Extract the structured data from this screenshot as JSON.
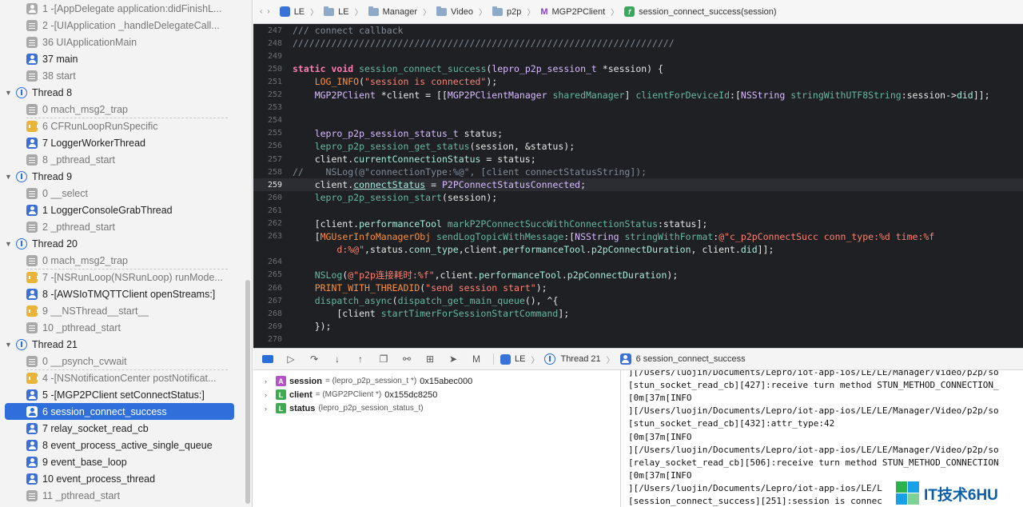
{
  "navigator": {
    "rows": [
      {
        "kind": "frame",
        "icon": "user",
        "dim": true,
        "label": "1 -[AppDelegate application:didFinishL..."
      },
      {
        "kind": "frame",
        "icon": "sys",
        "dim": true,
        "label": "2 -[UIApplication _handleDelegateCall..."
      },
      {
        "kind": "frame",
        "icon": "sys",
        "dim": true,
        "label": "36 UIApplicationMain"
      },
      {
        "kind": "frame",
        "icon": "user",
        "dim": false,
        "label": "37 main"
      },
      {
        "kind": "frame",
        "icon": "sys",
        "dim": true,
        "label": "38 start"
      },
      {
        "kind": "thread",
        "label": "Thread 8"
      },
      {
        "kind": "frame",
        "icon": "sys",
        "dim": true,
        "label": "0 mach_msg2_trap"
      },
      {
        "kind": "frame",
        "icon": "lib",
        "dim": true,
        "label": "6 CFRunLoopRunSpecific",
        "sepBefore": true
      },
      {
        "kind": "frame",
        "icon": "user",
        "dim": false,
        "label": "7 LoggerWorkerThread"
      },
      {
        "kind": "frame",
        "icon": "sys",
        "dim": true,
        "label": "8 _pthread_start"
      },
      {
        "kind": "thread",
        "label": "Thread 9"
      },
      {
        "kind": "frame",
        "icon": "sys",
        "dim": true,
        "label": "0 __select"
      },
      {
        "kind": "frame",
        "icon": "user",
        "dim": false,
        "label": "1 LoggerConsoleGrabThread"
      },
      {
        "kind": "frame",
        "icon": "sys",
        "dim": true,
        "label": "2 _pthread_start"
      },
      {
        "kind": "thread",
        "label": "Thread 20"
      },
      {
        "kind": "frame",
        "icon": "sys",
        "dim": true,
        "label": "0 mach_msg2_trap"
      },
      {
        "kind": "frame",
        "icon": "lib",
        "dim": true,
        "label": "7 -[NSRunLoop(NSRunLoop) runMode...",
        "sepBefore": true
      },
      {
        "kind": "frame",
        "icon": "user",
        "dim": false,
        "label": "8 -[AWSIoTMQTTClient openStreams:]"
      },
      {
        "kind": "frame",
        "icon": "lib",
        "dim": true,
        "label": "9 __NSThread__start__"
      },
      {
        "kind": "frame",
        "icon": "sys",
        "dim": true,
        "label": "10 _pthread_start"
      },
      {
        "kind": "thread",
        "label": "Thread 21"
      },
      {
        "kind": "frame",
        "icon": "sys",
        "dim": true,
        "label": "0 __psynch_cvwait"
      },
      {
        "kind": "frame",
        "icon": "lib",
        "dim": true,
        "label": "4 -[NSNotificationCenter postNotificat...",
        "sepBefore": true
      },
      {
        "kind": "frame",
        "icon": "user",
        "dim": false,
        "label": "5 -[MGP2PClient setConnectStatus:]"
      },
      {
        "kind": "frame",
        "icon": "user",
        "dim": false,
        "selected": true,
        "label": "6 session_connect_success"
      },
      {
        "kind": "frame",
        "icon": "user",
        "dim": false,
        "label": "7 relay_socket_read_cb"
      },
      {
        "kind": "frame",
        "icon": "user",
        "dim": false,
        "label": "8 event_process_active_single_queue"
      },
      {
        "kind": "frame",
        "icon": "user",
        "dim": false,
        "label": "9 event_base_loop"
      },
      {
        "kind": "frame",
        "icon": "user",
        "dim": false,
        "label": "10 event_process_thread"
      },
      {
        "kind": "frame",
        "icon": "sys",
        "dim": true,
        "label": "11 _pthread_start"
      }
    ]
  },
  "jumpbar": {
    "crumbs": [
      {
        "icon": "project",
        "label": "LE"
      },
      {
        "icon": "folder",
        "label": "LE"
      },
      {
        "icon": "folder",
        "label": "Manager"
      },
      {
        "icon": "folder",
        "label": "Video"
      },
      {
        "icon": "folder",
        "label": "p2p"
      },
      {
        "icon": "m",
        "label": "MGP2PClient"
      },
      {
        "icon": "f",
        "label": "session_connect_success(session)"
      }
    ],
    "m_glyph": "M",
    "f_glyph": "f"
  },
  "editor": {
    "current_line": 259,
    "lines": [
      {
        "n": "247",
        "html": "<span class=\"cm\">/// connect callback</span>"
      },
      {
        "n": "248",
        "html": "<span class=\"cm\">/////////////////////////////////////////////////////////////////////</span>"
      },
      {
        "n": "249",
        "html": ""
      },
      {
        "n": "250",
        "html": "<span class=\"kw\">static</span> <span class=\"kw\">void</span> <span class=\"fn\">session_connect_success</span>(<span class=\"ty\">lepro_p2p_session_t</span> *session) {"
      },
      {
        "n": "251",
        "html": "    <span class=\"mc\">LOG_INFO</span>(<span class=\"str\">\"session is connected\"</span>);"
      },
      {
        "n": "252",
        "html": "    <span class=\"ty\">MGP2PClient</span> *client = [[<span class=\"ty\">MGP2PClientManager</span> <span class=\"fn\">sharedManager</span>] <span class=\"fn\">clientForDeviceId</span>:[<span class=\"ty\">NSString</span> <span class=\"fn\">stringWithUTF8String</span>:session-><span class=\"prop\">did</span>]];"
      },
      {
        "n": "253",
        "html": ""
      },
      {
        "n": "254",
        "html": ""
      },
      {
        "n": "255",
        "html": "    <span class=\"ty\">lepro_p2p_session_status_t</span> status;"
      },
      {
        "n": "256",
        "html": "    <span class=\"fn\">lepro_p2p_session_get_status</span>(session, &amp;status);"
      },
      {
        "n": "257",
        "html": "    client.<span class=\"prop\">currentConnectionStatus</span> = status;"
      },
      {
        "n": "258",
        "html": "<span class=\"cm\">//    NSLog(@\"connectionType:%@\", [client connectStatusString]);</span>"
      },
      {
        "n": "259",
        "html": "    client.<span class=\"prop lk\">connectStatus</span> = <span class=\"ty\">P2PConnectStatusConnected</span>;"
      },
      {
        "n": "260",
        "html": "    <span class=\"fn\">lepro_p2p_session_start</span>(session);"
      },
      {
        "n": "261",
        "html": ""
      },
      {
        "n": "262",
        "html": "    [client.<span class=\"prop\">performanceTool</span> <span class=\"fn\">markP2PConnectSuccWithConnectionStatus</span>:status];"
      },
      {
        "n": "263",
        "html": "    [<span class=\"mc\">MGUserInfoManagerObj</span> <span class=\"fn\">sendLogTopicWithMessage</span>:[<span class=\"ty\">NSString</span> <span class=\"fn\">stringWithFormat</span>:<span class=\"str\">@\"c_p2pConnectSucc conn_type:%d time:%f</span>"
      },
      {
        "n": "",
        "html": "        <span class=\"str\">d:%@\"</span>,status.<span class=\"prop\">conn_type</span>,client.<span class=\"prop\">performanceTool</span>.<span class=\"prop\">p2pConnectDuration</span>, client.<span class=\"prop\">did</span>]];"
      },
      {
        "n": "264",
        "html": ""
      },
      {
        "n": "265",
        "html": "    <span class=\"fn\">NSLog</span>(<span class=\"str\">@\"p2p连接耗时:%f\"</span>,client.<span class=\"prop\">performanceTool</span>.<span class=\"prop\">p2pConnectDuration</span>);"
      },
      {
        "n": "266",
        "html": "    <span class=\"mc\">PRINT_WITH_THREADID</span>(<span class=\"str\">\"send session start\"</span>);"
      },
      {
        "n": "267",
        "html": "    <span class=\"fn\">dispatch_async</span>(<span class=\"fn\">dispatch_get_main_queue</span>(), ^{"
      },
      {
        "n": "268",
        "html": "        [client <span class=\"fn\">startTimerForSessionStartCommand</span>];"
      },
      {
        "n": "269",
        "html": "    });"
      },
      {
        "n": "270",
        "html": ""
      }
    ]
  },
  "debugbar": {
    "buttons": [
      "breakpoints-toggle",
      "continue",
      "step-over",
      "step-into",
      "step-out",
      "debug-view-hierarchy",
      "memory-graph",
      "environment-overrides",
      "simulate-location",
      "metal-frame"
    ],
    "path": [
      {
        "icon": "project",
        "label": "LE"
      },
      {
        "icon": "thread",
        "label": "Thread 21"
      },
      {
        "icon": "user",
        "label": "6 session_connect_success"
      }
    ]
  },
  "variables": {
    "rows": [
      {
        "badge": "A",
        "name": "session",
        "type": "= (lepro_p2p_session_t *)",
        "value": "0x15abec000"
      },
      {
        "badge": "L",
        "name": "client",
        "type": "= (MGP2PClient *)",
        "value": "0x155dc8250"
      },
      {
        "badge": "L",
        "name": "status",
        "type": "(lepro_p2p_session_status_t)",
        "value": ""
      }
    ]
  },
  "console": {
    "lines": [
      "][/Users/luojin/Documents/Lepro/iot-app-ios/LE/LE/Manager/Video/p2p/so",
      "[stun_socket_read_cb][427]:receive turn method STUN_METHOD_CONNECTION_",
      "[0m[37m[INFO",
      "][/Users/luojin/Documents/Lepro/iot-app-ios/LE/LE/Manager/Video/p2p/so",
      "[stun_socket_read_cb][432]:attr_type:42",
      "[0m[37m[INFO",
      "][/Users/luojin/Documents/Lepro/iot-app-ios/LE/LE/Manager/Video/p2p/so",
      "[relay_socket_read_cb][506]:receive turn method STUN_METHOD_CONNECTION",
      "[0m[37m[INFO",
      "][/Users/luojin/Documents/Lepro/iot-app-ios/LE/L",
      "[session_connect_success][251]:session is connec"
    ]
  },
  "watermark": {
    "text": "IT技术6HU"
  },
  "colors": {
    "accent": "#2f6fdb",
    "editor_bg": "#1f2023",
    "current_line_bg": "#2b2d33"
  }
}
